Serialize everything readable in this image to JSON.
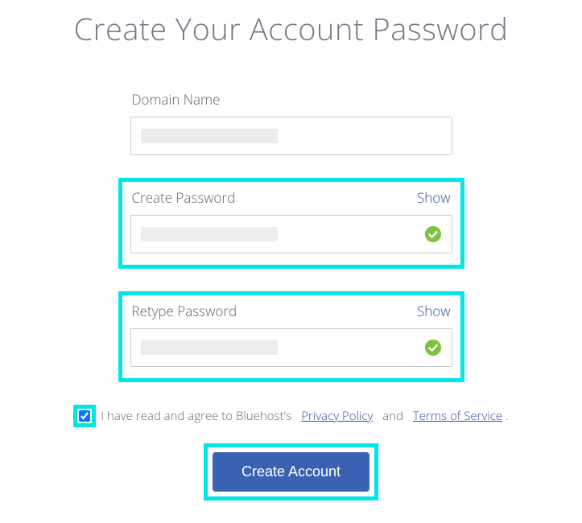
{
  "title": "Create Your Account Password",
  "fields": {
    "domain": {
      "label": "Domain Name",
      "value": ""
    },
    "password": {
      "label": "Create Password",
      "show_label": "Show",
      "valid": true
    },
    "retype": {
      "label": "Retype Password",
      "show_label": "Show",
      "valid": true
    }
  },
  "terms": {
    "checked": true,
    "text_prefix": "I have read and agree to Bluehost's",
    "privacy_label": "Privacy Policy",
    "connector": "and",
    "tos_label": "Terms of Service",
    "suffix": "."
  },
  "submit_label": "Create Account",
  "colors": {
    "highlight": "#00e5e5",
    "button": "#3a62b3",
    "link": "#2b4f9e",
    "title": "#6f7a87",
    "success": "#7fc241"
  }
}
